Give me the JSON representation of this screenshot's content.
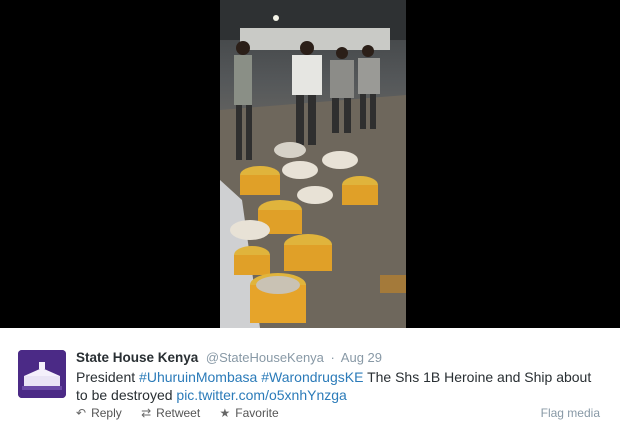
{
  "tweet": {
    "fullname": "State House Kenya",
    "username": "@StateHouseKenya",
    "separator": "·",
    "time": "Aug 29",
    "text_parts": {
      "p1": "President ",
      "hashtag1": "#UhuruinMombasa",
      "sp": " ",
      "hashtag2": "#WarondrugsKE",
      "p2": " The Shs 1B Heroine and Ship about to be destroyed ",
      "link": "pic.twitter.com/o5xnhYnzga"
    }
  },
  "actions": {
    "reply": {
      "label": "Reply",
      "icon": "reply-icon"
    },
    "retweet": {
      "label": "Retweet",
      "icon": "retweet-icon"
    },
    "favorite": {
      "label": "Favorite",
      "icon": "star-icon"
    },
    "flag": "Flag media"
  },
  "colors": {
    "link": "#2b7bb9",
    "muted": "#8899a6",
    "avatar_bg": "#4b2a86"
  }
}
